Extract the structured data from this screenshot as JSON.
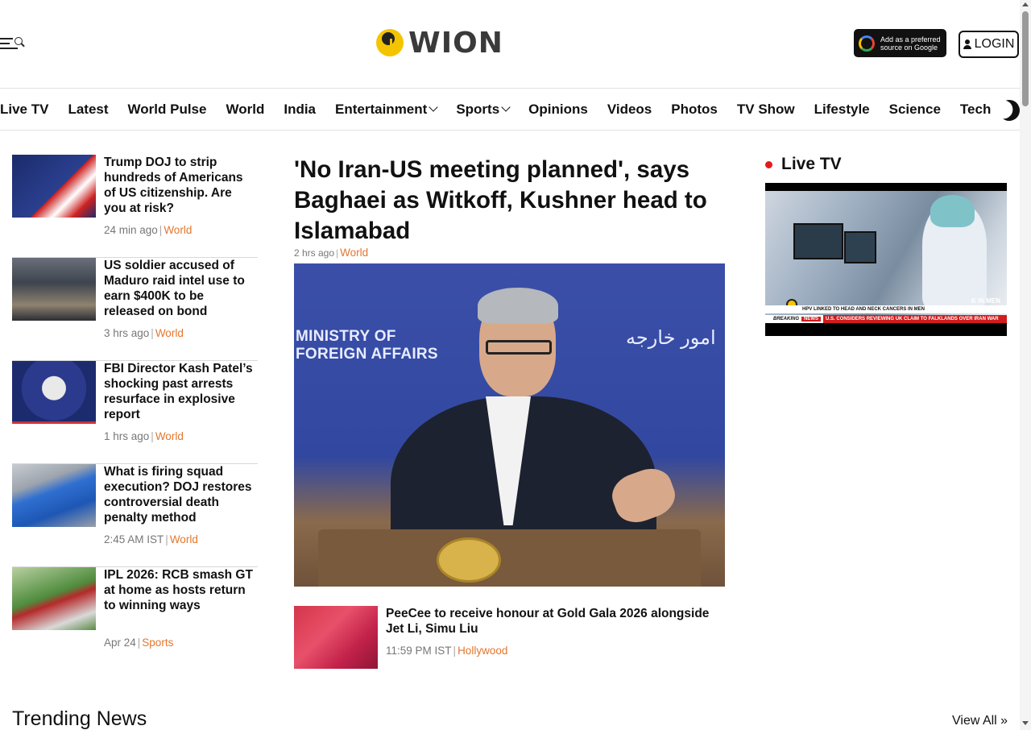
{
  "header": {
    "logo_text": "WION",
    "google_badge": "Add as a preferred source on Google",
    "login_label": "LOGIN"
  },
  "nav": {
    "items": [
      {
        "label": "Live TV"
      },
      {
        "label": "Latest"
      },
      {
        "label": "World Pulse"
      },
      {
        "label": "World"
      },
      {
        "label": "India"
      },
      {
        "label": "Entertainment"
      },
      {
        "label": "Sports"
      },
      {
        "label": "Opinions"
      },
      {
        "label": "Videos"
      },
      {
        "label": "Photos"
      },
      {
        "label": "TV Show"
      },
      {
        "label": "Lifestyle"
      },
      {
        "label": "Science"
      },
      {
        "label": "Tech"
      }
    ]
  },
  "side_stories": [
    {
      "title": "Trump DOJ to strip hundreds of Americans of US citizenship. Are you at risk?",
      "time": "24 min ago",
      "category": "World"
    },
    {
      "title": "US soldier accused of Maduro raid intel use to earn $400K to be released on bond",
      "time": "3 hrs ago",
      "category": "World"
    },
    {
      "title": "FBI Director Kash Patel’s shocking past arrests resurface in explosive report",
      "time": "1 hrs ago",
      "category": "World"
    },
    {
      "title": "What is firing squad execution? DOJ restores controversial death penalty method",
      "time": "2:45 AM IST",
      "category": "World"
    },
    {
      "title": "IPL 2026: RCB smash GT at home as hosts return to winning ways",
      "time": "Apr 24",
      "category": "Sports"
    }
  ],
  "main_story": {
    "title": "'No Iran-US meeting planned', says Baghaei as Witkoff, Kushner head to Islamabad",
    "time": "2 hrs ago",
    "category": "World",
    "image_text_line1": "MINISTRY OF",
    "image_text_line2": "FOREIGN AFFAIRS",
    "image_script": "امور خارجه"
  },
  "secondary_story": {
    "title": "PeeCee to receive honour at Gold Gala 2026 alongside Jet Li, Simu Liu",
    "time": "11:59 PM IST",
    "category": "Hollywood"
  },
  "live_tv": {
    "label": "Live TV",
    "ticker_tag": "K IN MEN",
    "ticker_line1": "HPV LINKED TO HEAD AND NECK CANCERS IN MEN",
    "breaking": "BREAKING",
    "news": "NEWS",
    "ticker_line2": "U.S. CONSIDERS REVIEWING UK CLAIM TO FALKLANDS OVER IRAN WAR"
  },
  "trending": {
    "title": "Trending News",
    "view_all": "View All »"
  },
  "colors": {
    "accent": "#e4762e",
    "live_dot": "#e41b1b",
    "logo_yellow": "#f5c400"
  }
}
